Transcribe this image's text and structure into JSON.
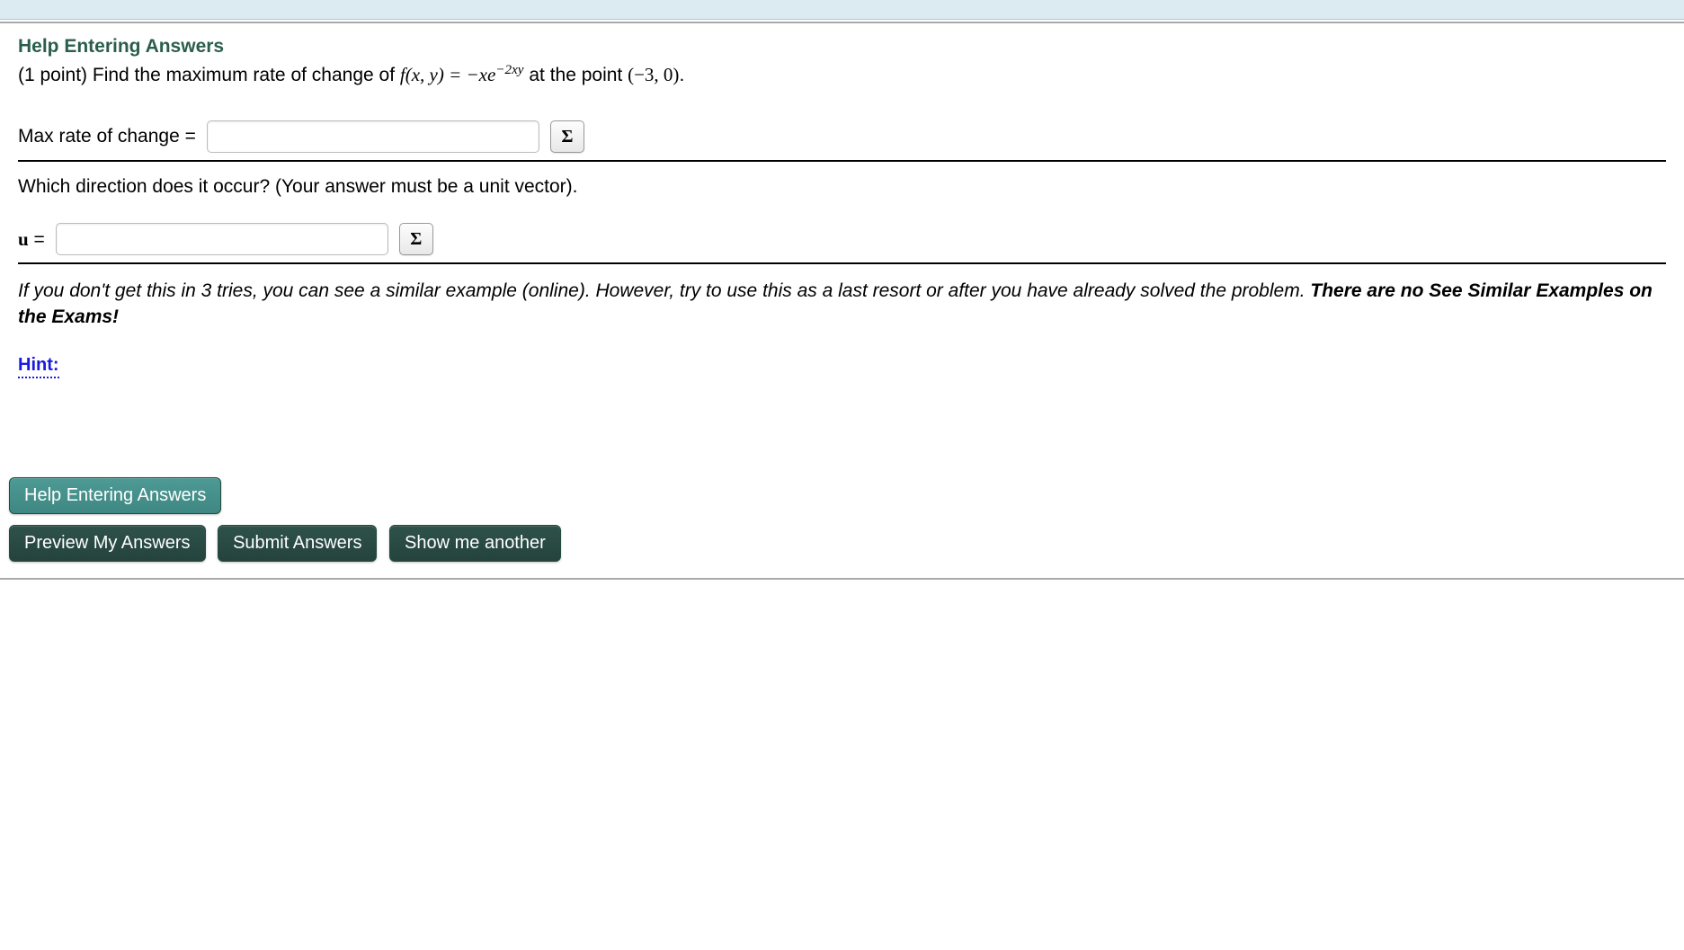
{
  "help_heading": "Help Entering Answers",
  "problem": {
    "points_prefix": "(1 point) Find the maximum rate of change of ",
    "func_lhs": "f(x, y) = ",
    "func_rhs_prefix": "−xe",
    "func_exp": "−2xy",
    "at_text": " at the point ",
    "point": "(−3, 0)",
    "period": "."
  },
  "input1": {
    "label": "Max rate of change =",
    "sigma": "Σ"
  },
  "direction_q": "Which direction does it occur? (Your answer must be a unit vector).",
  "input2": {
    "label_u": "u",
    "label_eq": " =",
    "sigma": "Σ"
  },
  "note": {
    "text1": "If you don't get this in 3 tries, you can see a similar example (online). However, try to use this as a last resort or after you have already solved the problem. ",
    "strong": "There are no See Similar Examples on the Exams!"
  },
  "hint_label": "Hint:",
  "buttons": {
    "help": "Help Entering Answers",
    "preview": "Preview My Answers",
    "submit": "Submit Answers",
    "another": "Show me another"
  }
}
